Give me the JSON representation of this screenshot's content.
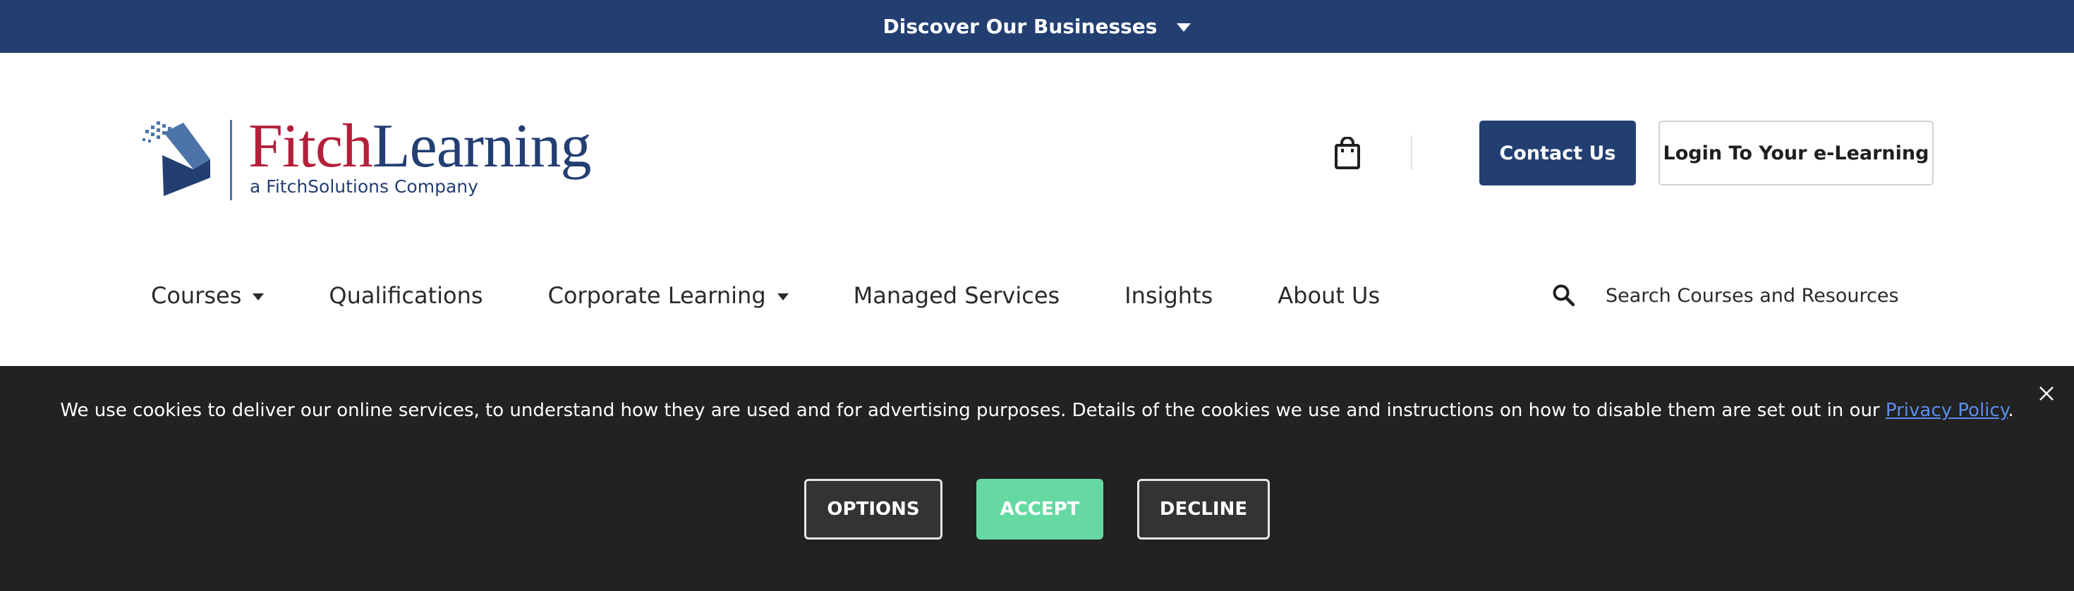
{
  "topbar": {
    "label": "Discover Our Businesses"
  },
  "brand": {
    "word1": "Fitch",
    "word2": "Learning",
    "tagline": "a FitchSolutions Company",
    "colors": {
      "red": "#b41f3a",
      "navy": "#233f72",
      "light_blue": "#4d74a9"
    }
  },
  "header": {
    "contact_label": "Contact Us",
    "login_label": "Login To Your e-Learning"
  },
  "nav": {
    "items": [
      {
        "label": "Courses",
        "has_dropdown": true
      },
      {
        "label": "Qualifications",
        "has_dropdown": false
      },
      {
        "label": "Corporate Learning",
        "has_dropdown": true
      },
      {
        "label": "Managed Services",
        "has_dropdown": false
      },
      {
        "label": "Insights",
        "has_dropdown": false
      },
      {
        "label": "About Us",
        "has_dropdown": false
      }
    ]
  },
  "search": {
    "placeholder": "Search Courses and Resources"
  },
  "cookie": {
    "text": "We use cookies to deliver our online services, to understand how they are used and for advertising purposes. Details of the cookies we use and instructions on how to disable them are set out in our ",
    "link_label": "Privacy Policy",
    "suffix": ".",
    "options_label": "OPTIONS",
    "accept_label": "ACCEPT",
    "decline_label": "DECLINE",
    "accept_color": "#66d9a3"
  },
  "icons": [
    "chevron-down-icon",
    "shopping-bag-icon",
    "search-icon",
    "close-icon"
  ]
}
